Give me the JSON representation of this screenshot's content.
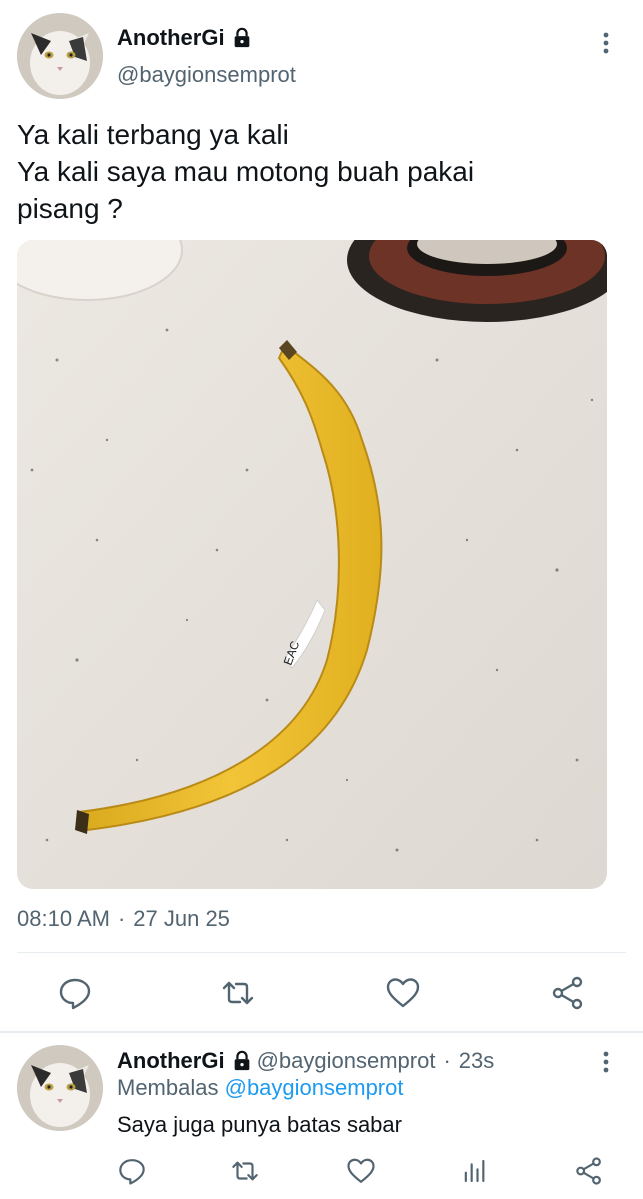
{
  "tweet": {
    "display_name": "AnotherGi",
    "handle": "@baygionsemprot",
    "text_lines": [
      "Ya kali terbang ya kali",
      "Ya kali saya mau motong buah pakai",
      "pisang ?"
    ],
    "time": "08:10 AM",
    "separator": "·",
    "date": "27 Jun 25",
    "media_label": "EAC",
    "icons": {
      "lock": "lock-icon",
      "more": "more-vertical-icon",
      "reply": "reply-icon",
      "retweet": "retweet-icon",
      "like": "heart-icon",
      "share": "share-icon"
    }
  },
  "reply": {
    "display_name": "AnotherGi",
    "handle": "@baygionsemprot",
    "separator": "·",
    "time": "23s",
    "replying_prefix": "Membalas",
    "replying_to": "@baygionsemprot",
    "text": "Saya juga punya batas sabar",
    "icons": {
      "reply": "reply-icon",
      "retweet": "retweet-icon",
      "like": "heart-icon",
      "analytics": "analytics-icon",
      "share": "share-icon"
    }
  },
  "colors": {
    "text": "#0f1419",
    "secondary": "#536471",
    "link": "#1d9bf0",
    "divider": "#e6ecf0"
  }
}
